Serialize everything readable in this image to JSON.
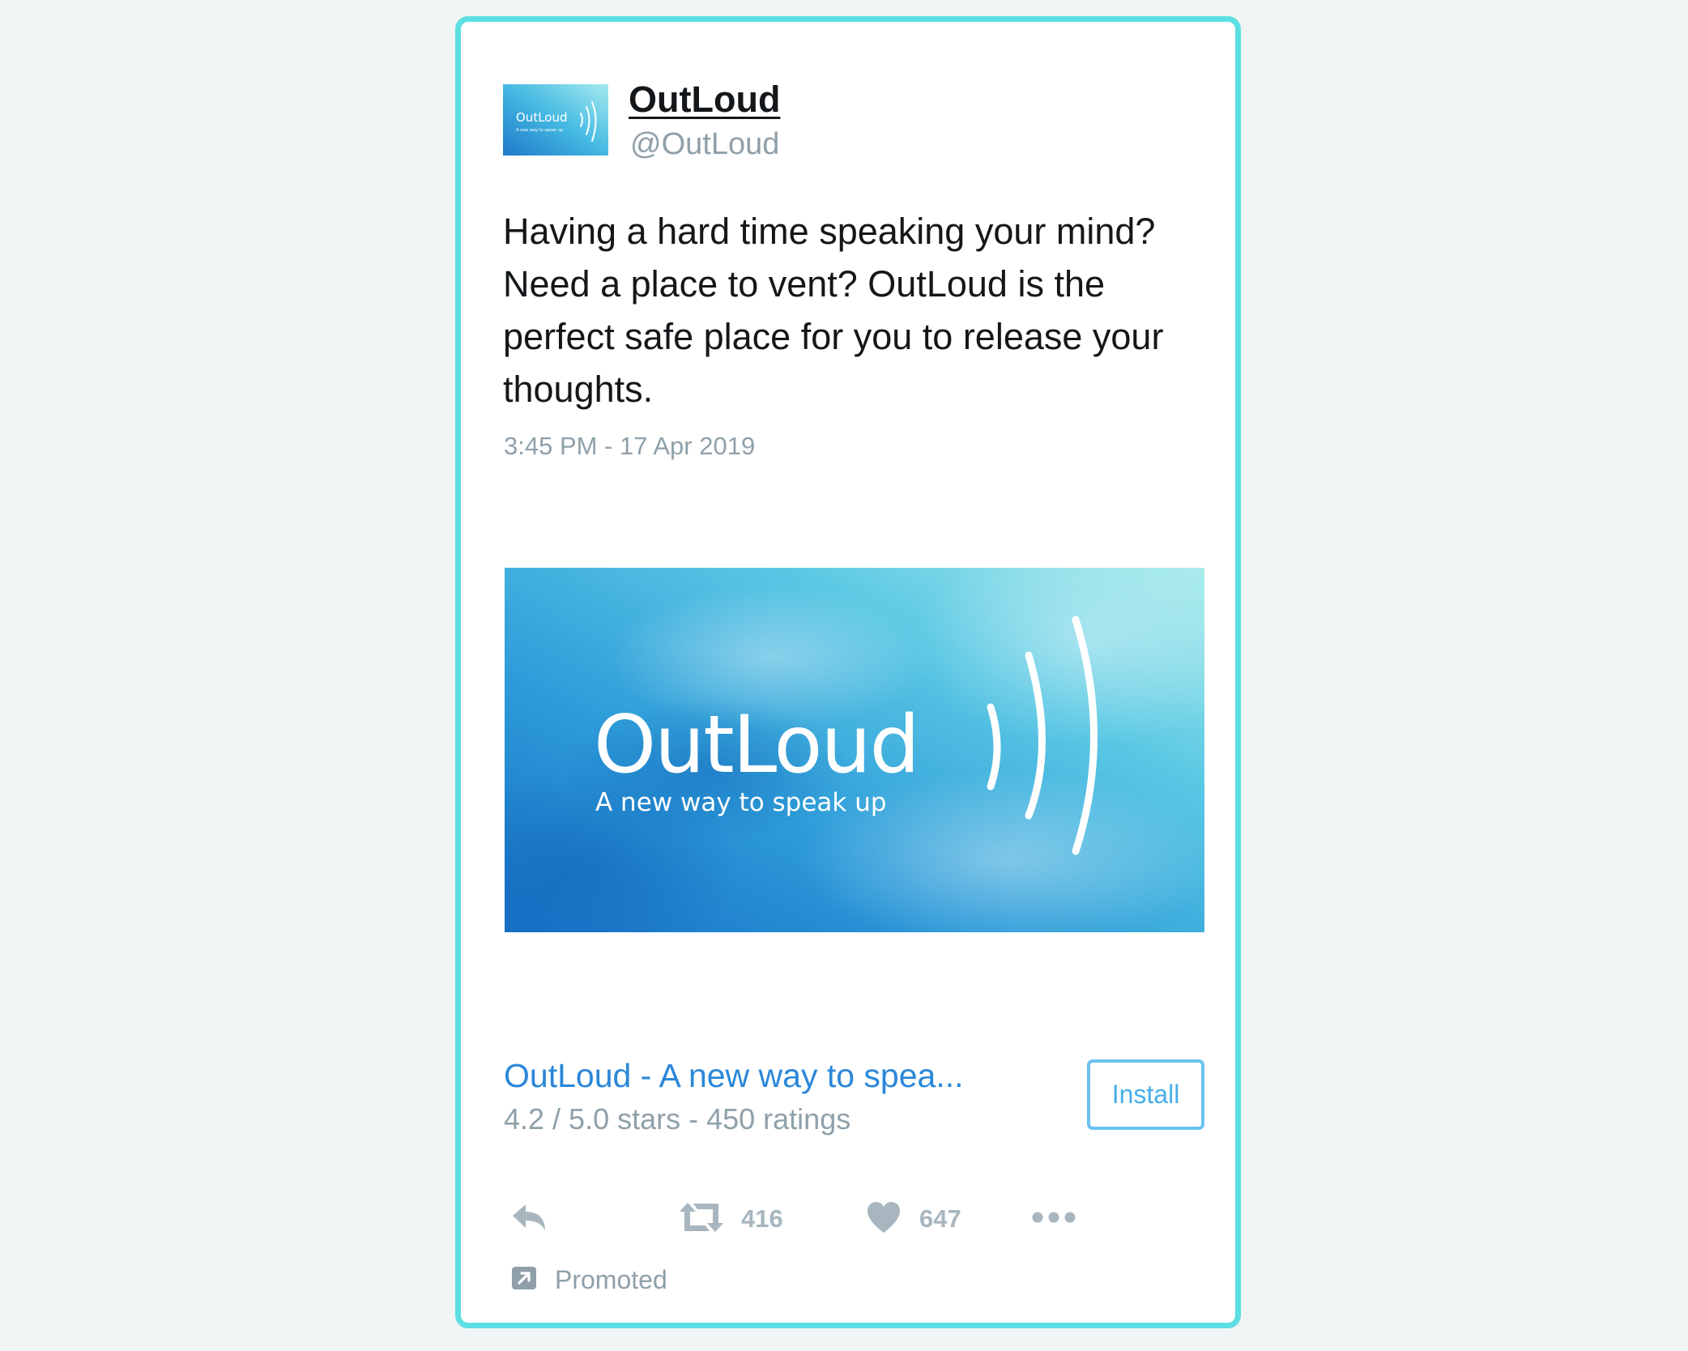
{
  "tweet": {
    "display_name": "OutLoud",
    "handle": "@OutLoud",
    "text": "Having a hard time speaking your mind? Need a place to vent? OutLoud is the perfect safe place for you to release your thoughts.",
    "timestamp": "3:45 PM - 17 Apr 2019",
    "avatar": {
      "logo_text": "OutLoud",
      "tagline": "A new way to speak up"
    },
    "media": {
      "logo_text": "OutLoud",
      "tagline": "A new way to speak up"
    },
    "app_card": {
      "title": "OutLoud - A new way to spea...",
      "rating": "4.2 / 5.0 stars - 450 ratings",
      "install_label": "Install"
    },
    "actions": {
      "reply_icon": "reply-icon",
      "retweet_icon": "retweet-icon",
      "retweet_count": "416",
      "like_icon": "heart-icon",
      "like_count": "647",
      "more_icon": "more-dots-icon"
    },
    "promoted_label": "Promoted"
  },
  "colors": {
    "card_border": "#5cdfe2",
    "link_blue": "#2b87d9",
    "muted_gray": "#8fa0aa",
    "action_gray": "#a7b6bf",
    "install_border": "#69c2f0"
  }
}
